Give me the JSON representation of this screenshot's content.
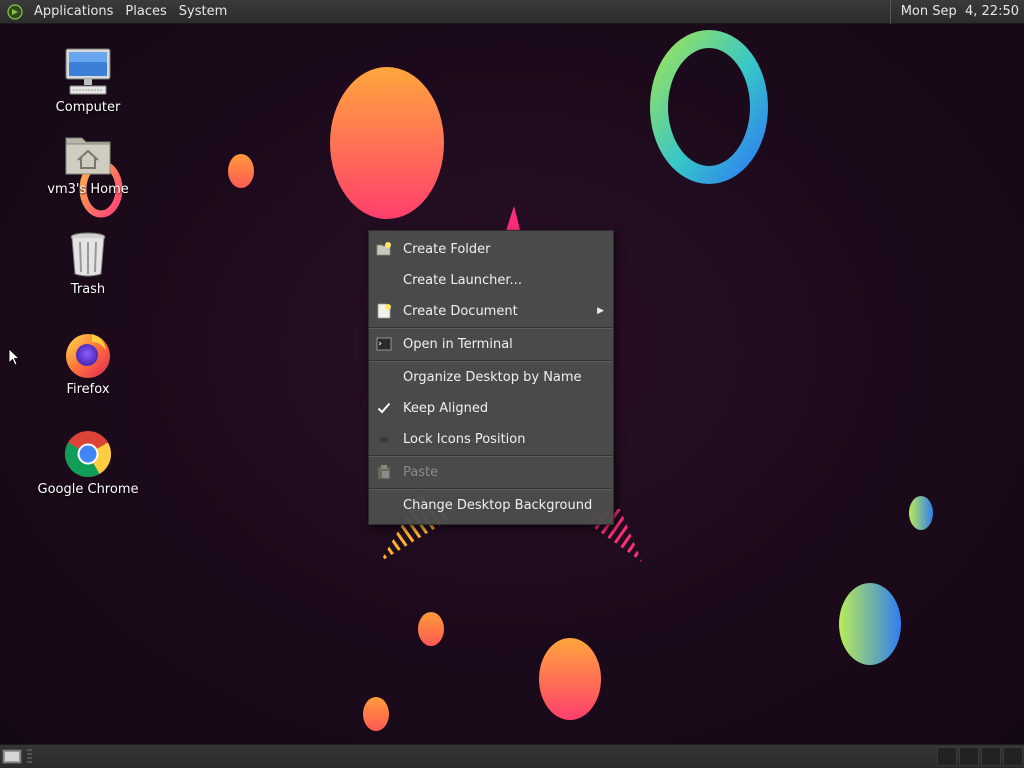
{
  "top_panel": {
    "menus": [
      "Applications",
      "Places",
      "System"
    ],
    "clock": "Mon Sep  4, 22:50"
  },
  "desktop": {
    "icons": [
      {
        "label": "Computer",
        "icon": "computer-icon"
      },
      {
        "label": "vm3's Home",
        "icon": "home-folder-icon"
      },
      {
        "label": "Trash",
        "icon": "trash-icon"
      },
      {
        "label": "Firefox",
        "icon": "firefox-icon"
      },
      {
        "label": "Google Chrome",
        "icon": "chrome-icon"
      }
    ]
  },
  "context_menu": {
    "items": [
      {
        "label": "Create Folder",
        "icon": "folder-new-icon",
        "enabled": true
      },
      {
        "label": "Create Launcher...",
        "enabled": true
      },
      {
        "label": "Create Document",
        "icon": "document-new-icon",
        "submenu": true,
        "enabled": true
      },
      {
        "label": "Open in Terminal",
        "icon": "terminal-icon",
        "enabled": true
      },
      {
        "label": "Organize Desktop by Name",
        "enabled": true
      },
      {
        "label": "Keep Aligned",
        "checked": true,
        "enabled": true
      },
      {
        "label": "Lock Icons Position",
        "checked": false,
        "enabled": true
      },
      {
        "label": "Paste",
        "icon": "paste-icon",
        "enabled": false
      },
      {
        "label": "Change Desktop Background",
        "enabled": true
      }
    ]
  },
  "colors": {
    "wallpaper": "#1e0c1f",
    "menu_bg": "#4c4c4c",
    "panel_bg": "#2e2e2e"
  }
}
